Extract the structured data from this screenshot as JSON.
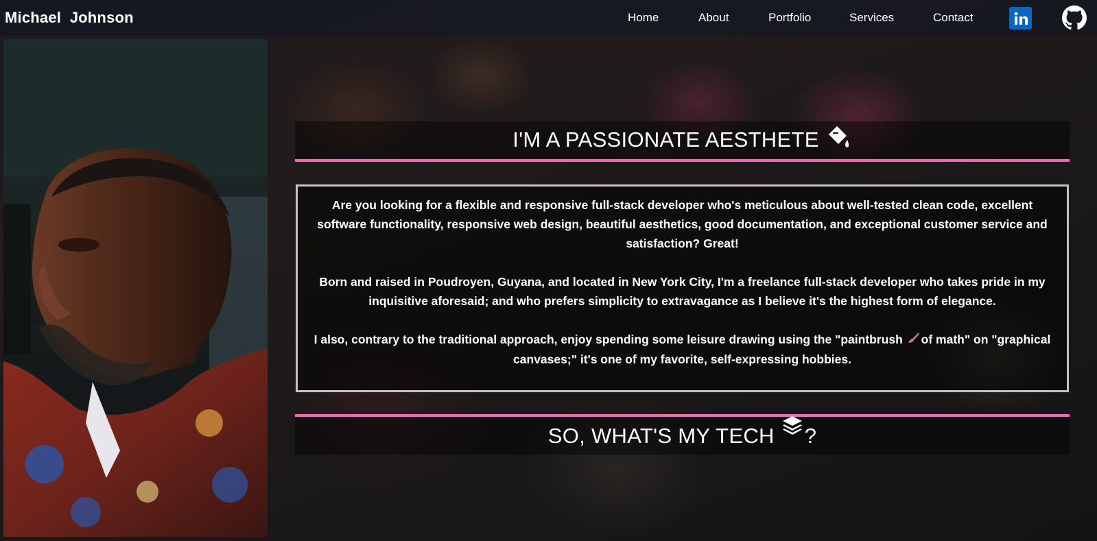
{
  "navbar": {
    "brand": "Michael  Johnson",
    "links": [
      "Home",
      "About",
      "Portfolio",
      "Services",
      "Contact"
    ],
    "social_icons": [
      "linkedin-icon",
      "github-icon"
    ]
  },
  "profile_photo": {
    "subject": "portrait photo"
  },
  "about": {
    "title": "I'M A PASSIONATE AESTHETE",
    "title_icon": "paint-bucket-icon",
    "paragraphs": [
      "Are you looking for a flexible and responsive full-stack developer who's meticulous about well-tested clean code, excellent software functionality, responsive web design, beautiful aesthetics, good documentation, and exceptional customer service and satisfaction? Great!",
      "Born and raised in Poudroyen, Guyana, and located in New York City, I'm a freelance full-stack developer who takes pride in my inquisitive aforesaid; and who prefers simplicity to extravagance as I believe it's the highest form of elegance.",
      "I also, contrary to the traditional approach, enjoy spending some leisure drawing using the \"paintbrush",
      "of math\" on \"graphical canvases;\" it's one of my favorite, self-expressing hobbies."
    ],
    "inline_icon": "paintbrush-icon"
  },
  "tech": {
    "title": "SO, WHAT'S MY TECH",
    "title_suffix": "?",
    "title_icon": "layers-icon"
  },
  "colors": {
    "accent_pink": "#f06bb3",
    "navbar_bg": "#141822",
    "linkedin_blue": "#0a66c2",
    "box_border": "#c7c1c7"
  }
}
